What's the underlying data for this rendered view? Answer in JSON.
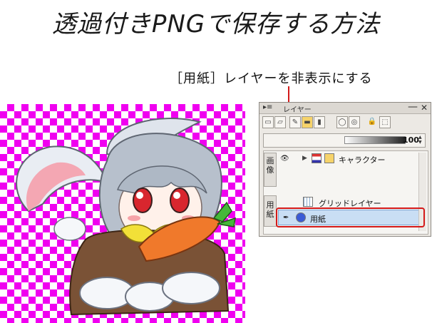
{
  "heading": "透過付きPNGで保存する方法",
  "callout": "［用紙］レイヤーを非表示にする",
  "panel": {
    "tab_icon": "▸≡",
    "tab_label": "レイヤー",
    "minimize": "—",
    "close": "✕",
    "opacity_value": "100",
    "side_tabs": [
      {
        "text": "画像"
      },
      {
        "text": "用紙"
      }
    ],
    "layers": [
      {
        "name": "キャラクター",
        "type": "folder",
        "visible": true
      },
      {
        "name": "グリッドレイヤー",
        "type": "grid",
        "visible": false
      },
      {
        "name": "用紙",
        "type": "paper",
        "visible": false,
        "selected": true
      }
    ],
    "toolbar_icons": [
      "new-raster-icon",
      "new-vector-icon",
      "new-layer-icon",
      "folder-icon",
      "trash-icon",
      "mask-icon",
      "mask-apply-icon",
      "lock-icon",
      "selection-icon"
    ]
  },
  "colors": {
    "accent_red": "#d41a1a",
    "checker": "#f000f0",
    "selection": "#c9def4"
  }
}
